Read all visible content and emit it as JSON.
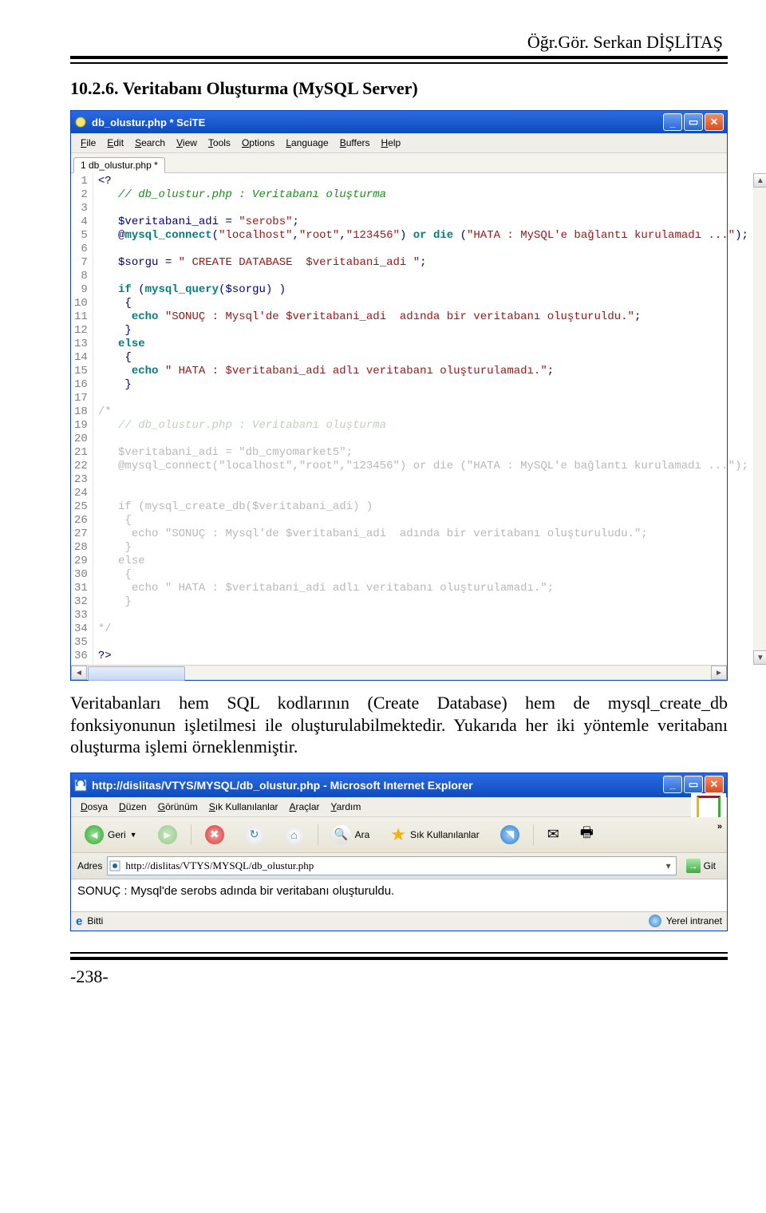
{
  "page": {
    "author_header": "Öğr.Gör. Serkan DİŞLİTAŞ",
    "section_title": "10.2.6. Veritabanı Oluşturma (MySQL Server)",
    "body_text": "Veritabanları hem SQL kodlarının (Create Database) hem de mysql_create_db fonksiyonunun işletilmesi ile oluşturulabilmektedir. Yukarıda her iki yöntemle veritabanı oluşturma işlemi örneklenmiştir.",
    "page_number": "-238-"
  },
  "scite": {
    "title": "db_olustur.php * SciTE",
    "menus": [
      "File",
      "Edit",
      "Search",
      "View",
      "Tools",
      "Options",
      "Language",
      "Buffers",
      "Help"
    ],
    "tab": "1 db_olustur.php *",
    "lines": [
      {
        "n": 1,
        "html": "<span class='c-op'>&lt;?</span>"
      },
      {
        "n": 2,
        "html": "   <span class='c-com'>// db_olustur.php : Veritabanı oluşturma</span>"
      },
      {
        "n": 3,
        "html": ""
      },
      {
        "n": 4,
        "html": "   <span class='c-var'>$veritabani_adi</span> <span class='c-op'>=</span> <span class='c-str'>\"serobs\"</span><span class='c-op'>;</span>"
      },
      {
        "n": 5,
        "html": "   <span class='c-op'>@</span><span class='c-kw'>mysql_connect</span><span class='c-op'>(</span><span class='c-str'>\"localhost\"</span><span class='c-op'>,</span><span class='c-str'>\"root\"</span><span class='c-op'>,</span><span class='c-str'>\"123456\"</span><span class='c-op'>)</span> <span class='c-kw'>or</span> <span class='c-kw'>die</span> <span class='c-op'>(</span><span class='c-str'>\"HATA : MySQL'e bağlantı kurulamadı ...\"</span><span class='c-op'>);</span>"
      },
      {
        "n": 6,
        "html": ""
      },
      {
        "n": 7,
        "html": "   <span class='c-var'>$sorgu</span> <span class='c-op'>=</span> <span class='c-str'>\" CREATE DATABASE  $veritabani_adi \"</span><span class='c-op'>;</span>"
      },
      {
        "n": 8,
        "html": ""
      },
      {
        "n": 9,
        "html": "   <span class='c-kw'>if</span> <span class='c-op'>(</span><span class='c-kw'>mysql_query</span><span class='c-op'>(</span><span class='c-var'>$sorgu</span><span class='c-op'>)</span> <span class='c-op'>)</span>"
      },
      {
        "n": 10,
        "html": "    <span class='c-op'>{</span>"
      },
      {
        "n": 11,
        "html": "     <span class='c-kw'>echo</span> <span class='c-str'>\"SONUÇ : Mysql'de $veritabani_adi  adında bir veritabanı oluşturuldu.\"</span><span class='c-op'>;</span>"
      },
      {
        "n": 12,
        "html": "    <span class='c-op'>}</span>"
      },
      {
        "n": 13,
        "html": "   <span class='c-kw'>else</span>"
      },
      {
        "n": 14,
        "html": "    <span class='c-op'>{</span>"
      },
      {
        "n": 15,
        "html": "     <span class='c-kw'>echo</span> <span class='c-str'>\" HATA : $veritabani_adi adlı veritabanı oluşturulamadı.\"</span><span class='c-op'>;</span>"
      },
      {
        "n": 16,
        "html": "    <span class='c-op'>}</span>"
      },
      {
        "n": 17,
        "html": ""
      },
      {
        "n": 18,
        "html": "<span class='c-gray'>/*</span>"
      },
      {
        "n": 19,
        "html": "   <span class='c-graycom'>// db_olustur.php : Veritabanı oluşturma</span>"
      },
      {
        "n": 20,
        "html": ""
      },
      {
        "n": 21,
        "html": "   <span class='c-gray'>$veritabani_adi = \"db_cmyomarket5\";</span>"
      },
      {
        "n": 22,
        "html": "   <span class='c-gray'>@mysql_connect(\"localhost\",\"root\",\"123456\") or die (\"HATA : MySQL'e bağlantı kurulamadı ...\");</span>"
      },
      {
        "n": 23,
        "html": ""
      },
      {
        "n": 24,
        "html": ""
      },
      {
        "n": 25,
        "html": "   <span class='c-gray'>if (mysql_create_db($veritabani_adi) )</span>"
      },
      {
        "n": 26,
        "html": "    <span class='c-gray'>{</span>"
      },
      {
        "n": 27,
        "html": "     <span class='c-gray'>echo \"SONUÇ : Mysql'de $veritabani_adi  adında bir veritabanı oluşturuludu.\";</span>"
      },
      {
        "n": 28,
        "html": "    <span class='c-gray'>}</span>"
      },
      {
        "n": 29,
        "html": "   <span class='c-gray'>else</span>"
      },
      {
        "n": 30,
        "html": "    <span class='c-gray'>{</span>"
      },
      {
        "n": 31,
        "html": "     <span class='c-gray'>echo \" HATA : $veritabani_adi adlı veritabanı oluşturulamadı.\";</span>"
      },
      {
        "n": 32,
        "html": "    <span class='c-gray'>}</span>"
      },
      {
        "n": 33,
        "html": ""
      },
      {
        "n": 34,
        "html": "<span class='c-gray'>*/</span>"
      },
      {
        "n": 35,
        "html": ""
      },
      {
        "n": 36,
        "html": "<span class='c-op'>?&gt;</span>"
      }
    ]
  },
  "ie": {
    "title": "http://dislitas/VTYS/MYSQL/db_olustur.php - Microsoft Internet Explorer",
    "menus": [
      "Dosya",
      "Düzen",
      "Görünüm",
      "Sık Kullanılanlar",
      "Araçlar",
      "Yardım"
    ],
    "toolbar": {
      "back": "Geri",
      "search": "Ara",
      "favorites": "Sık Kullanılanlar"
    },
    "address_label": "Adres",
    "address_value": "http://dislitas/VTYS/MYSQL/db_olustur.php",
    "go_label": "Git",
    "content": "SONUÇ : Mysql'de serobs adında bir veritabanı oluşturuldu.",
    "status_left": "Bitti",
    "status_right": "Yerel intranet"
  }
}
